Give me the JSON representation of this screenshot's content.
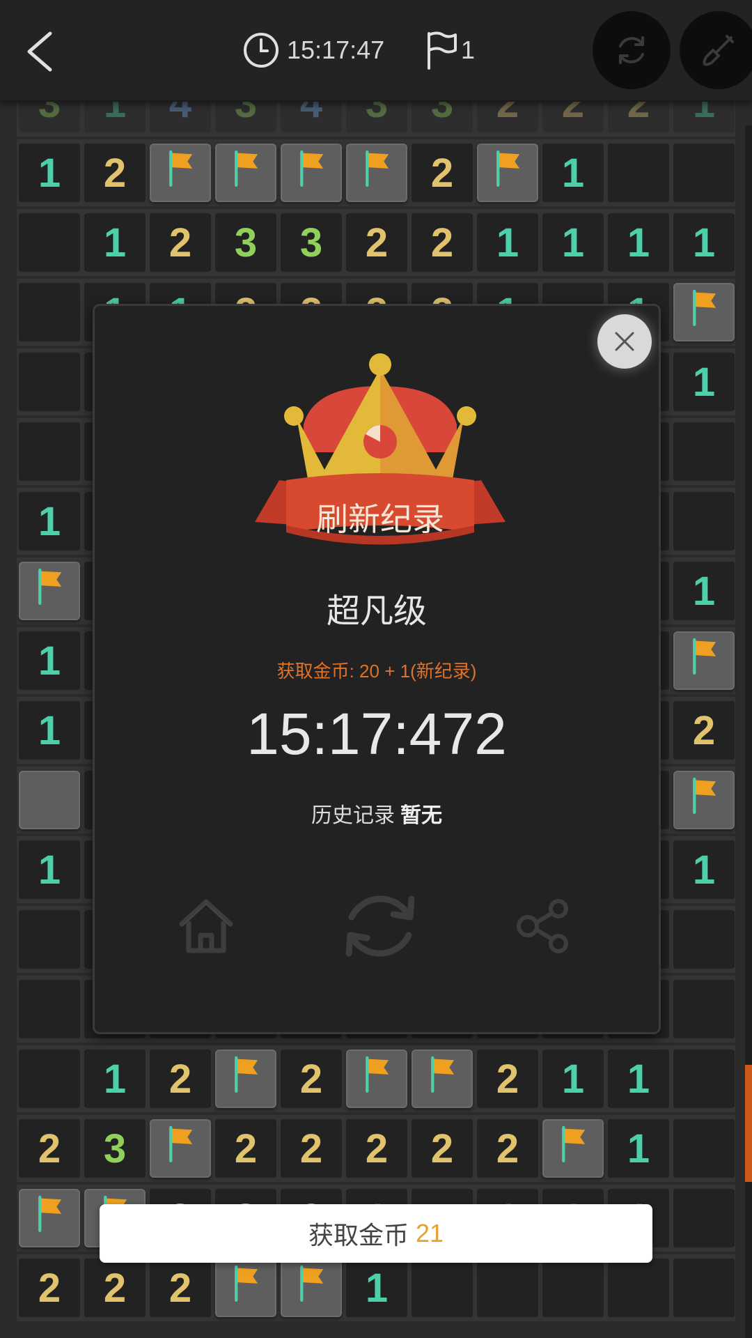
{
  "header": {
    "timer": "15:17:47",
    "flags": "1"
  },
  "colors": {
    "number_1": "#4dcfaa",
    "number_2": "#e2c36d",
    "number_3": "#90d15c",
    "number_4": "#6fa6e6",
    "flag": "#f0a020",
    "accent": "#cc5a1a"
  },
  "board": {
    "rows": [
      [
        "3",
        "1",
        "4",
        "3",
        "4",
        "3",
        "3",
        "2",
        "2",
        "2",
        "1"
      ],
      [
        "1",
        "2",
        "F",
        "F",
        "F",
        "F",
        "2",
        "F",
        "1",
        "",
        ""
      ],
      [
        "",
        "1",
        "2",
        "3",
        "3",
        "2",
        "2",
        "1",
        "1",
        "1",
        "1"
      ],
      [
        "",
        "1",
        "1",
        "2",
        "2",
        "2",
        "2",
        "1",
        "",
        "1",
        "F"
      ],
      [
        "",
        "",
        "",
        "",
        "",
        "",
        "",
        "",
        "",
        "",
        "1"
      ],
      [
        "",
        "",
        "",
        "",
        "",
        "",
        "",
        "",
        "",
        "",
        ""
      ],
      [
        "1",
        "",
        "",
        "",
        "",
        "",
        "",
        "",
        "",
        "",
        ""
      ],
      [
        "F",
        "",
        "",
        "",
        "",
        "",
        "",
        "",
        "",
        "",
        "1"
      ],
      [
        "1",
        "",
        "",
        "",
        "",
        "",
        "",
        "",
        "",
        "",
        "F"
      ],
      [
        "1",
        "",
        "",
        "",
        "",
        "",
        "",
        "",
        "",
        "",
        "2"
      ],
      [
        "R",
        "",
        "",
        "",
        "",
        "",
        "",
        "",
        "",
        "",
        "F"
      ],
      [
        "1",
        "",
        "",
        "",
        "",
        "",
        "",
        "",
        "",
        "",
        "1"
      ],
      [
        "",
        "",
        "",
        "",
        "",
        "",
        "",
        "",
        "",
        "",
        ""
      ],
      [
        "",
        "",
        "",
        "",
        "",
        "",
        "",
        "",
        "",
        "",
        ""
      ],
      [
        "",
        "1",
        "2",
        "F",
        "2",
        "F",
        "F",
        "2",
        "1",
        "1",
        ""
      ],
      [
        "2",
        "3",
        "F",
        "2",
        "2",
        "2",
        "2",
        "2",
        "F",
        "1",
        ""
      ],
      [
        "F",
        "F",
        "3",
        "3",
        "2",
        "1",
        "",
        "1",
        "1",
        "1",
        ""
      ],
      [
        "2",
        "2",
        "2",
        "F",
        "F",
        "1",
        "",
        "",
        "",
        "",
        ""
      ]
    ]
  },
  "modal": {
    "banner": "刷新纪录",
    "level": "超凡级",
    "coins_earned": "获取金币: 20 + 1(新纪录)",
    "time": "15:17:472",
    "history_label": "历史记录",
    "history_value": "暂无"
  },
  "toast": {
    "label": "获取金币",
    "amount": "21"
  }
}
